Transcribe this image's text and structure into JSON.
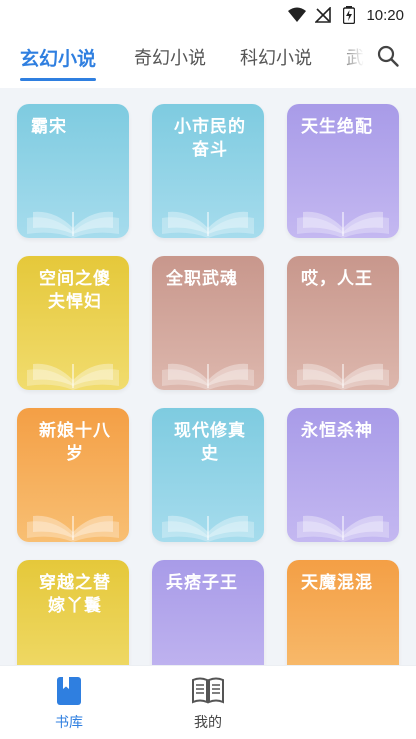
{
  "status_bar": {
    "time": "10:20",
    "icons": [
      "wifi-icon",
      "no-signal-icon",
      "battery-icon"
    ]
  },
  "tabs": [
    {
      "label": "玄幻小说",
      "active": true
    },
    {
      "label": "奇幻小说",
      "active": false
    },
    {
      "label": "科幻小说",
      "active": false
    },
    {
      "label": "武",
      "active": false
    }
  ],
  "books": [
    {
      "title": "霸宋",
      "color": "blue"
    },
    {
      "title": "小市民的奋斗",
      "color": "blue"
    },
    {
      "title": "天生绝配",
      "color": "purple"
    },
    {
      "title": "空间之傻夫悍妇",
      "color": "yellow"
    },
    {
      "title": "全职武魂",
      "color": "brown"
    },
    {
      "title": "哎，人王",
      "color": "brown"
    },
    {
      "title": "新娘十八岁",
      "color": "orange"
    },
    {
      "title": "现代修真史",
      "color": "blue"
    },
    {
      "title": "永恒杀神",
      "color": "purple"
    },
    {
      "title": "穿越之替嫁丫鬟",
      "color": "yellow"
    },
    {
      "title": "兵痞子王",
      "color": "purple"
    },
    {
      "title": "天魔混混",
      "color": "orange"
    }
  ],
  "palette": {
    "blue": [
      "#7ecbe0",
      "#a6dced"
    ],
    "purple": [
      "#a89be8",
      "#c4b8f1"
    ],
    "yellow": [
      "#e5c83a",
      "#f1dc6e"
    ],
    "brown": [
      "#c8978c",
      "#ddb7ad"
    ],
    "orange": [
      "#f49f45",
      "#f8bf73"
    ],
    "accent": "#2f7fe0"
  },
  "bottom_nav": [
    {
      "label": "书库",
      "icon": "bookmark-book-icon",
      "active": true
    },
    {
      "label": "我的",
      "icon": "open-book-icon",
      "active": false
    }
  ]
}
